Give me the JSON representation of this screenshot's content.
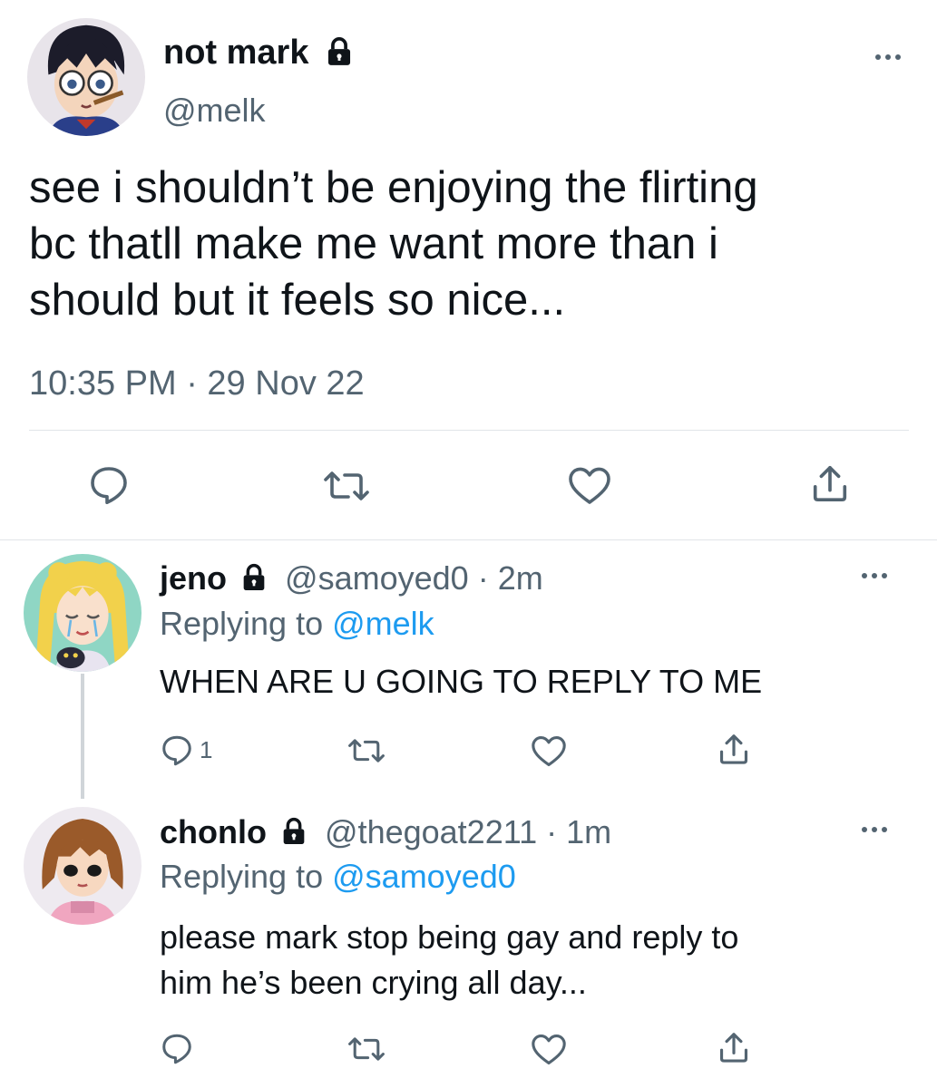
{
  "main_tweet": {
    "display_name": "not mark",
    "handle": "@melk",
    "text_lines": [
      "see i shouldn’t be enjoying the flirting",
      "bc thatll make me want more than i",
      "should but it feels so nice..."
    ],
    "timestamp": "10:35 PM · 29 Nov 22",
    "icons": [
      "reply-icon",
      "retweet-icon",
      "like-icon",
      "share-icon"
    ]
  },
  "replies": [
    {
      "display_name": "jeno",
      "handle": "@samoyed0",
      "time": "· 2m",
      "replying_prefix": "Replying to",
      "replying_to": "@melk",
      "text_lines": [
        "WHEN ARE U GOING TO REPLY TO ME"
      ],
      "reply_count": "1"
    },
    {
      "display_name": "chonlo",
      "handle": "@thegoat2211",
      "time": "· 1m",
      "replying_prefix": "Replying to",
      "replying_to": "@samoyed0",
      "text_lines": [
        "please mark stop being gay and reply to",
        "him he’s been crying all day..."
      ],
      "reply_count": ""
    }
  ],
  "colors": {
    "text": "#0f1419",
    "secondary": "#536471",
    "link": "#1d9bf0",
    "divider": "#e1e5e8"
  }
}
